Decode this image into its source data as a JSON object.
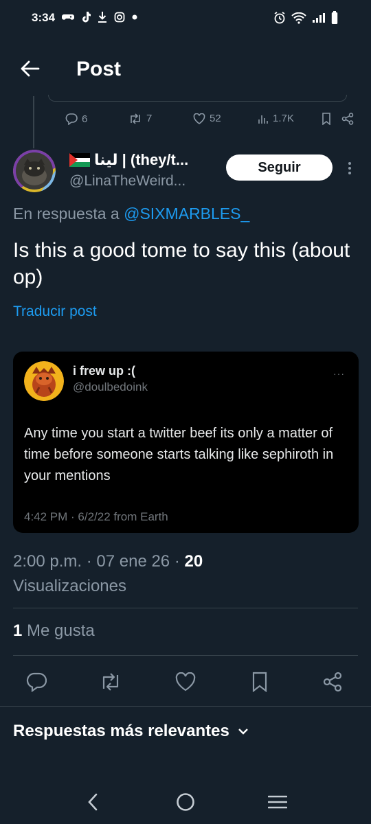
{
  "status_bar": {
    "time": "3:34",
    "left_icons": [
      "gamepad-icon",
      "tiktok-icon",
      "download-icon",
      "instagram-icon",
      "dot-icon"
    ],
    "right_icons": [
      "alarm-icon",
      "wifi-icon",
      "signal-icon",
      "battery-icon"
    ]
  },
  "header": {
    "title": "Post"
  },
  "previous_tweet_actions": {
    "replies": "6",
    "reposts": "7",
    "likes": "52",
    "views": "1.7K"
  },
  "tweet": {
    "author_name": "لينا | (they/t...",
    "author_handle": "@LinaTheWeird...",
    "follow_label": "Seguir",
    "reply_prefix": "En respuesta a",
    "reply_mention": "@SIXMARBLES_",
    "text": "Is this a good tome to say this (about op)",
    "translate_label": "Traducir post",
    "timestamp": "2:00 p.m. · 07 ene 26 · ",
    "views_count": "20",
    "views_label": "Visualizaciones",
    "likes_count": "1",
    "likes_label": "Me gusta"
  },
  "embedded_post": {
    "name": "i frew up :(",
    "handle": "@doulbedoink",
    "more": "···",
    "text": "Any time you start a twitter beef its only a matter of time before someone starts talking like sephiroth in your mentions",
    "meta": "4:42 PM · 6/2/22 from Earth"
  },
  "replies_section": {
    "label": "Respuestas más relevantes"
  },
  "colors": {
    "background": "#15202b",
    "accent": "#1d9bf0",
    "muted": "#8b98a5",
    "divider": "#38444d"
  }
}
